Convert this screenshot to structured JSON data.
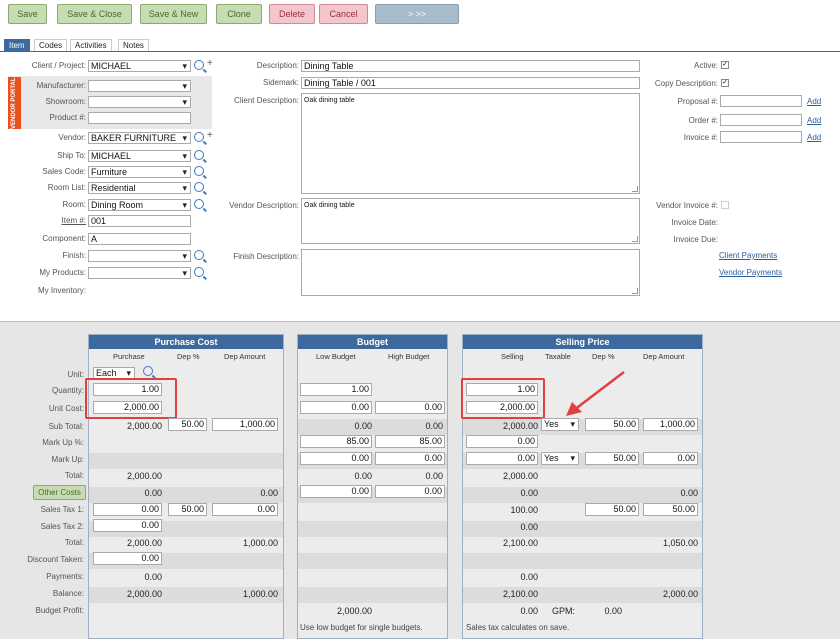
{
  "toolbar": {
    "save": "Save",
    "save_close": "Save & Close",
    "save_new": "Save & New",
    "clone": "Clone",
    "delete": "Delete",
    "cancel": "Cancel",
    "next": ">  >>"
  },
  "tabs": [
    "Item",
    "Codes",
    "Activities",
    "Notes"
  ],
  "vendor_portal": "VENDOR PORTAL",
  "left": {
    "client_project_label": "Client / Project:",
    "client_project": "MICHAEL",
    "manufacturer_label": "Manufacturer:",
    "showroom_label": "Showroom:",
    "product_label": "Product #:",
    "vendor_label": "Vendor:",
    "vendor": "BAKER FURNITURE",
    "ship_to_label": "Ship To:",
    "ship_to": "MICHAEL",
    "sales_code_label": "Sales Code:",
    "sales_code": "Furniture",
    "room_list_label": "Room List:",
    "room_list": "Residential",
    "room_label": "Room:",
    "room": "Dining Room",
    "item_label": "Item #:",
    "item": "001",
    "component_label": "Component:",
    "component": "A",
    "finish_label": "Finish:",
    "my_products_label": "My Products:",
    "my_inventory_label": "My Inventory:"
  },
  "middle": {
    "description_label": "Description:",
    "description": "Dining Table",
    "sidemark_label": "Sidemark:",
    "sidemark": "Dining Table / 001",
    "client_desc_label": "Client Description:",
    "client_desc": "Oak dining table",
    "vendor_desc_label": "Vendor Description:",
    "vendor_desc": "Oak dining table",
    "finish_desc_label": "Finish Description:"
  },
  "right": {
    "active_label": "Active:",
    "copy_desc_label": "Copy Description:",
    "proposal_label": "Proposal #:",
    "order_label": "Order #:",
    "invoice_label": "Invoice #:",
    "add": "Add",
    "vendor_invoice_label": "Vendor Invoice #:",
    "invoice_date_label": "Invoice Date:",
    "invoice_due_label": "Invoice Due:",
    "client_payments": "Client Payments",
    "vendor_payments": "Vendor Payments"
  },
  "rows": {
    "unit": "Unit:",
    "quantity": "Quantity:",
    "unit_cost": "Unit Cost:",
    "sub_total": "Sub Total:",
    "mark_up_pct": "Mark Up %:",
    "mark_up": "Mark Up:",
    "total": "Total:",
    "other_costs": "Other Costs",
    "sales_tax1": "Sales Tax 1:",
    "sales_tax2": "Sales Tax 2:",
    "total2": "Total:",
    "discount": "Discount Taken:",
    "payments": "Payments:",
    "balance": "Balance:",
    "budget_profit": "Budget Profit:"
  },
  "purchase": {
    "title": "Purchase Cost",
    "h_purchase": "Purchase",
    "h_dep_pct": "Dep %",
    "h_dep_amt": "Dep Amount",
    "unit": "Each",
    "quantity": "1.00",
    "unit_cost": "2,000.00",
    "sub_total": "2,000.00",
    "dep_pct": "50.00",
    "dep_amt": "1,000.00",
    "total": "2,000.00",
    "other_costs": "0.00",
    "other_dep_amt": "0.00",
    "tax1": "0.00",
    "tax1_pct": "50.00",
    "tax1_amt": "0.00",
    "tax2": "0.00",
    "total2": "2,000.00",
    "total2_dep": "1,000.00",
    "discount": "0.00",
    "payments": "0.00",
    "balance": "2,000.00",
    "balance_dep": "1,000.00"
  },
  "budget": {
    "title": "Budget",
    "h_low": "Low Budget",
    "h_high": "High Budget",
    "quantity": "1.00",
    "unit_cost": "0.00",
    "unit_cost_high": "0.00",
    "sub_total": "0.00",
    "sub_total_high": "0.00",
    "markup_pct": "85.00",
    "markup_pct_high": "85.00",
    "markup": "0.00",
    "markup_high": "0.00",
    "total": "0.00",
    "total_high": "0.00",
    "other": "0.00",
    "other_high": "0.00",
    "profit": "2,000.00",
    "note": "Use low budget for single budgets."
  },
  "selling": {
    "title": "Selling Price",
    "h_selling": "Selling",
    "h_taxable": "Taxable",
    "h_dep_pct": "Dep %",
    "h_dep_amt": "Dep Amount",
    "quantity": "1.00",
    "unit_cost": "2,000.00",
    "sub_total": "2,000.00",
    "taxable": "Yes",
    "dep_pct": "50.00",
    "dep_amt": "1,000.00",
    "markup_pct": "0.00",
    "markup": "0.00",
    "markup_taxable": "Yes",
    "markup_dep_pct": "50.00",
    "markup_dep_amt": "0.00",
    "total": "2,000.00",
    "other": "0.00",
    "other_dep": "0.00",
    "tax1": "100.00",
    "tax1_dep_pct": "50.00",
    "tax1_dep_amt": "50.00",
    "tax2": "0.00",
    "total2": "2,100.00",
    "total2_dep": "1,050.00",
    "payments": "0.00",
    "balance": "2,100.00",
    "balance_dep": "2,000.00",
    "profit": "0.00",
    "gpm_label": "GPM:",
    "gpm": "0.00",
    "note": "Sales tax calculates on save."
  }
}
